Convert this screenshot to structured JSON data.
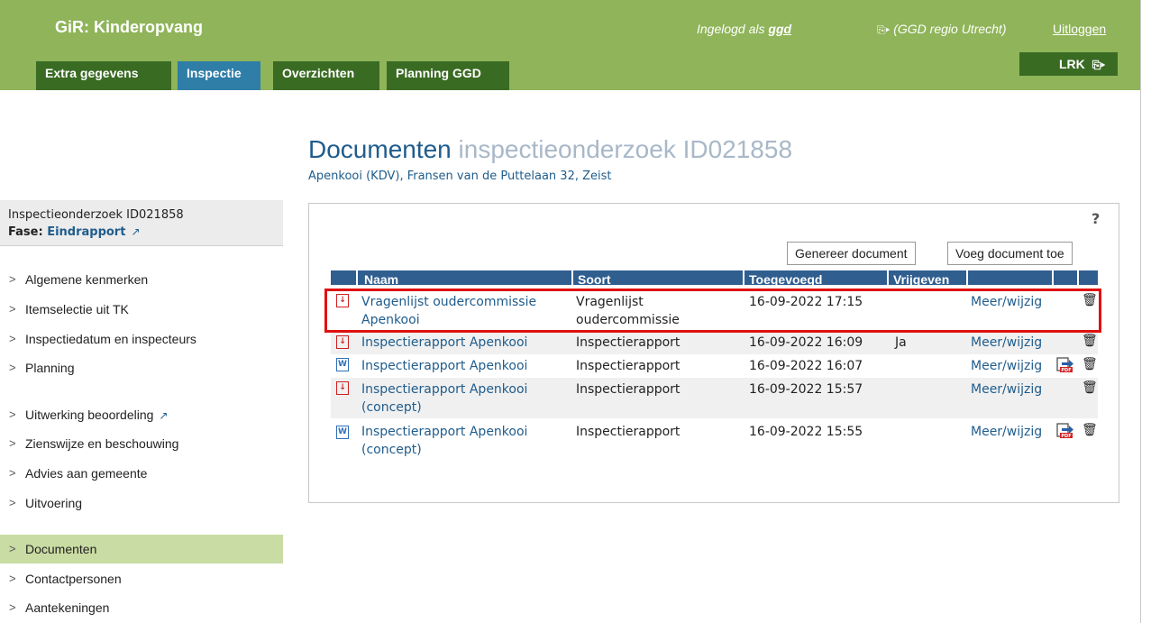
{
  "header": {
    "app_title": "GiR: Kinderopvang",
    "logged_in_prefix": "Ingelogd als ",
    "logged_in_user": "ggd",
    "region": "(GGD regio Utrecht)",
    "logout": "Uitloggen",
    "lrk": "LRK",
    "tabs": [
      {
        "label": "Extra gegevens",
        "active": false
      },
      {
        "label": "Inspectie",
        "active": true
      },
      {
        "label": "Overzichten",
        "active": false
      },
      {
        "label": "Planning GGD",
        "active": false
      }
    ]
  },
  "page": {
    "title_main": "Documenten",
    "title_sub": "inspectieonderzoek ID021858",
    "subtitle": "Apenkooi (KDV), Fransen van de Puttelaan 32, Zeist"
  },
  "sidebar": {
    "box_line1": "Inspectieonderzoek ID021858",
    "fase_label": "Fase:",
    "fase_value": "Eindrapport",
    "items": [
      {
        "label": "Algemene kenmerken"
      },
      {
        "label": "Itemselectie uit TK"
      },
      {
        "label": "Inspectiedatum en inspecteurs"
      },
      {
        "label": "Planning"
      },
      {
        "label": "Uitwerking beoordeling"
      },
      {
        "label": "Zienswijze en beschouwing"
      },
      {
        "label": "Advies aan gemeente"
      },
      {
        "label": "Uitvoering"
      },
      {
        "label": "Documenten"
      },
      {
        "label": "Contactpersonen"
      },
      {
        "label": "Aantekeningen"
      }
    ]
  },
  "panel": {
    "help": "?",
    "generate_button": "Genereer document",
    "add_button": "Voeg document toe",
    "columns": [
      "Naam",
      "Soort",
      "Toegevoegd",
      "Vrijgeven"
    ],
    "rows": [
      {
        "icon": "pdf-icon",
        "name_line1": "Vragenlijst oudercommissie",
        "name_line2": "Apenkooi",
        "soort_line1": "Vragenlijst",
        "soort_line2": "oudercommissie",
        "toegevoegd": "16-09-2022 17:15",
        "vrijgeven": "",
        "action": "Meer/wijzig"
      },
      {
        "icon": "pdf-icon",
        "name_line1": "Inspectierapport Apenkooi",
        "name_line2": "",
        "soort_line1": "Inspectierapport",
        "soort_line2": "",
        "toegevoegd": "16-09-2022 16:09",
        "vrijgeven": "Ja",
        "action": "Meer/wijzig"
      },
      {
        "icon": "word-icon",
        "name_line1": "Inspectierapport Apenkooi",
        "name_line2": "",
        "soort_line1": "Inspectierapport",
        "soort_line2": "",
        "toegevoegd": "16-09-2022 16:07",
        "vrijgeven": "",
        "action": "Meer/wijzig"
      },
      {
        "icon": "pdf-icon",
        "name_line1": "Inspectierapport Apenkooi",
        "name_line2": "(concept)",
        "soort_line1": "Inspectierapport",
        "soort_line2": "",
        "toegevoegd": "16-09-2022 15:57",
        "vrijgeven": "",
        "action": "Meer/wijzig"
      },
      {
        "icon": "word-icon",
        "name_line1": "Inspectierapport Apenkooi",
        "name_line2": "(concept)",
        "soort_line1": "Inspectierapport",
        "soort_line2": "",
        "toegevoegd": "16-09-2022 15:55",
        "vrijgeven": "",
        "action": "Meer/wijzig"
      }
    ]
  },
  "colors": {
    "header_green": "#8fb459",
    "tab_dark_green": "#3a6b23",
    "tab_active_blue": "#2f7ea8",
    "table_header_blue": "#2f5e8f",
    "link_blue": "#1f5c8c",
    "nav_active": "#c9dca3",
    "highlight_red": "#e01010"
  }
}
